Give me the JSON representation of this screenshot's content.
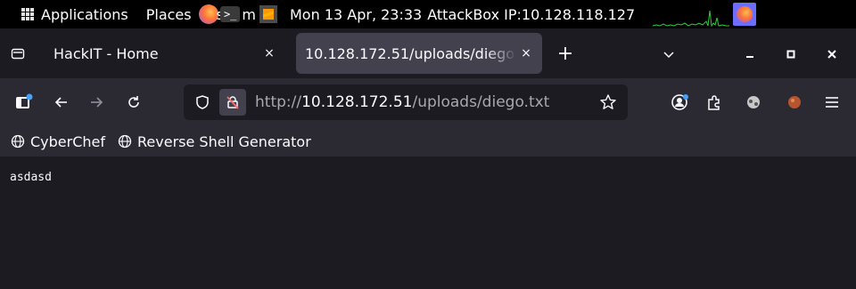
{
  "system_panel": {
    "applications_label": "Applications",
    "places_label": "Places",
    "system_partial": "s",
    "system_partial2": "m",
    "terminal_glyph": ">_",
    "clock": "Mon 13 Apr, 23:33",
    "ip_info": "AttackBox IP:10.128.118.127"
  },
  "tabs": [
    {
      "label": "HackIT - Home",
      "active": false
    },
    {
      "label": "10.128.172.51/uploads/diego.txt",
      "active": true
    }
  ],
  "tab_close_glyph": "×",
  "new_tab_glyph": "+",
  "urlbar": {
    "scheme": "http://",
    "host": "10.128.172.51",
    "path": "/uploads/diego.txt"
  },
  "bookmarks": [
    {
      "label": "CyberChef"
    },
    {
      "label": "Reverse Shell Generator"
    }
  ],
  "page_content": "asdasd",
  "icons": {
    "apps": "grid-icon",
    "tab_list": "tab-list-icon",
    "sidebar": "sidebar-icon",
    "back": "back-arrow-icon",
    "forward": "forward-arrow-icon",
    "reload": "reload-icon",
    "tracking": "shield-icon",
    "insecure": "insecure-lock-icon",
    "bookmark_star": "star-icon",
    "account": "account-icon",
    "extensions": "extensions-icon",
    "menu": "hamburger-menu-icon"
  },
  "colors": {
    "panel_bg": "#000000",
    "tab_bar_bg": "#1c1b22",
    "active_tab_bg": "#42414d",
    "toolbar_bg": "#2b2a33",
    "urlbar_bg": "#1c1b22",
    "text": "#fbfbfe",
    "insecure_red": "#ff6b6b",
    "notification_dot": "#45a1ff"
  }
}
